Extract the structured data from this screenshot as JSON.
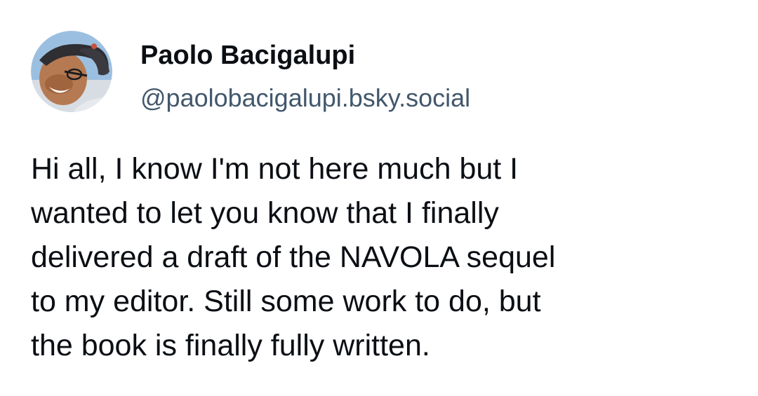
{
  "author": {
    "display_name": "Paolo Bacigalupi",
    "handle": "@paolobacigalupi.bsky.social"
  },
  "post": {
    "lines": [
      "Hi all, I know I'm not here much but I",
      "wanted to let you know that I finally",
      "delivered a draft of the NAVOLA sequel",
      "to my editor. Still some work to do, but",
      "the book is finally fully written."
    ]
  },
  "colors": {
    "text": "#0b0f14",
    "handle": "#42576c",
    "background": "#ffffff"
  },
  "icons": {
    "avatar": "user-avatar-photo"
  }
}
